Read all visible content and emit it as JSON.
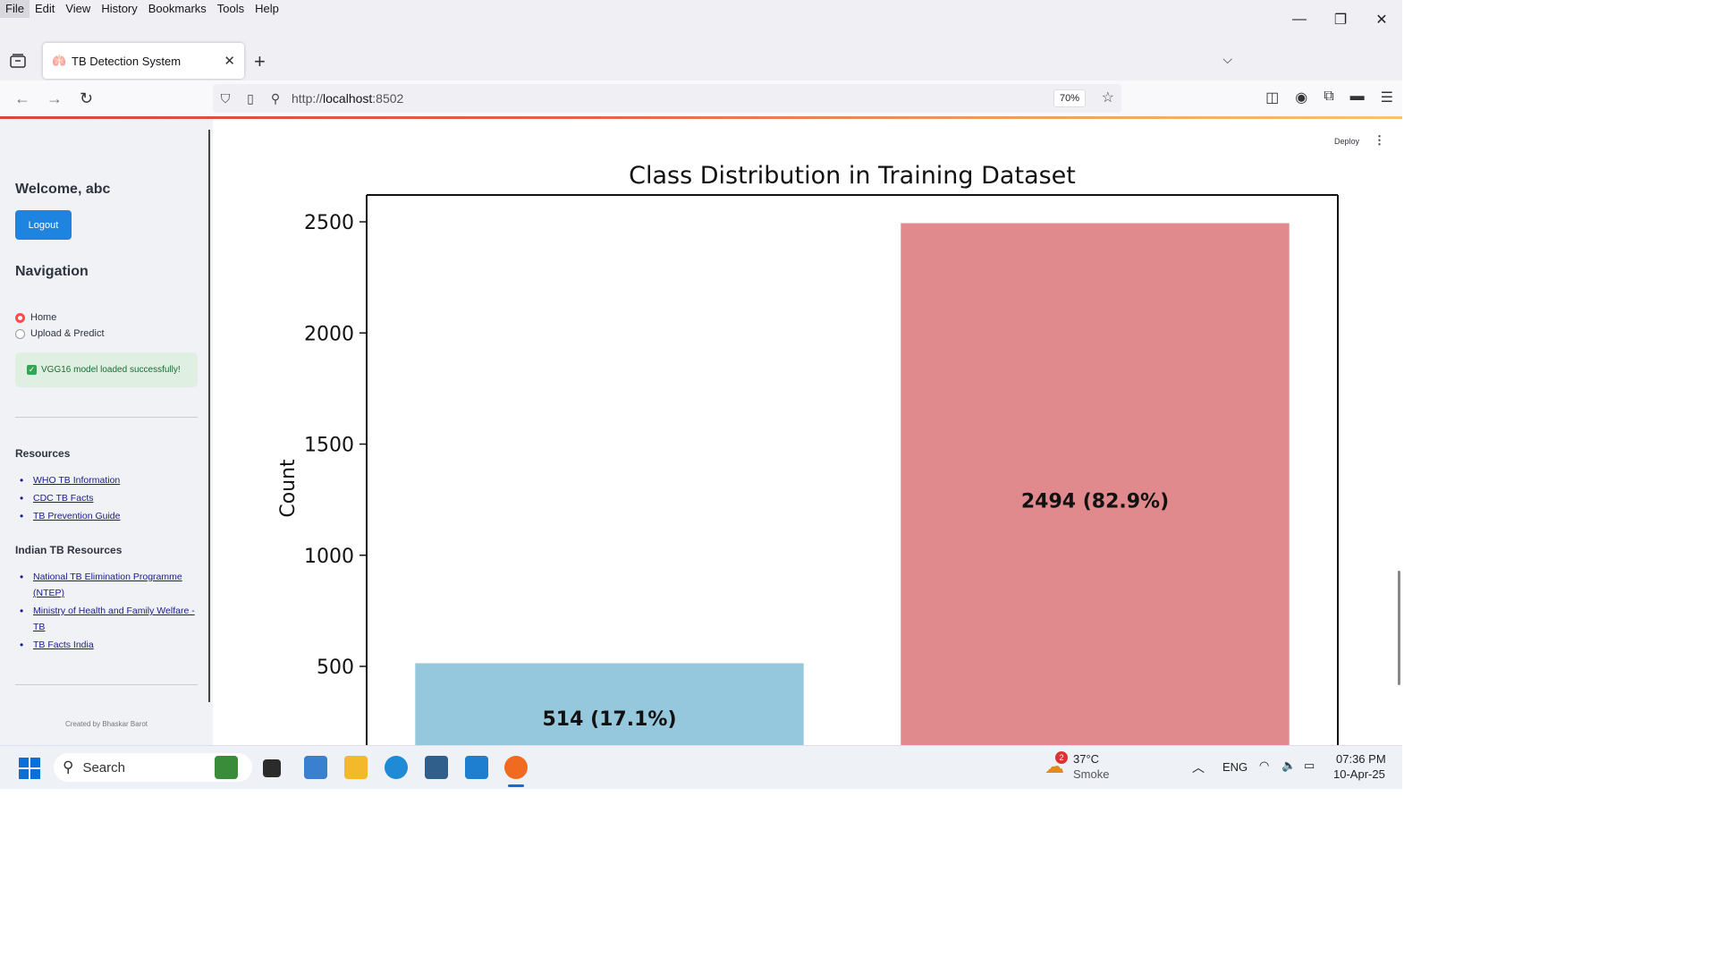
{
  "menu": [
    "File",
    "Edit",
    "View",
    "History",
    "Bookmarks",
    "Tools",
    "Help"
  ],
  "tab": {
    "title": "TB Detection System"
  },
  "urlbar": {
    "protocol": "http://",
    "host": "localhost",
    "port": ":8502",
    "zoom": "70%"
  },
  "sidebar": {
    "welcome": "Welcome, abc",
    "logout_label": "Logout",
    "nav_heading": "Navigation",
    "nav_options": [
      {
        "label": "Home",
        "selected": true
      },
      {
        "label": "Upload & Predict",
        "selected": false
      }
    ],
    "success_message": "VGG16 model loaded successfully!",
    "resources_heading": "Resources",
    "resources": [
      "WHO TB Information",
      "CDC TB Facts",
      "TB Prevention Guide"
    ],
    "indian_heading": "Indian TB Resources",
    "indian_resources": [
      "National TB Elimination Programme (NTEP)",
      "Ministry of Health and Family Welfare - TB",
      "TB Facts India"
    ],
    "credit": "Created by Bhaskar Barot"
  },
  "toolbar": {
    "deploy_label": "Deploy",
    "menu_icon": "kebab-icon"
  },
  "chart_data": {
    "type": "bar",
    "title": "Class Distribution in Training Dataset",
    "ylabel": "Count",
    "xlabel": "",
    "values": [
      514,
      2494
    ],
    "bar_labels": [
      "514 (17.1%)",
      "2494 (82.9%)"
    ],
    "colors": [
      "#95c8dc",
      "#e08a8d"
    ],
    "yticks": [
      "500",
      "1000",
      "1500",
      "2000",
      "2500"
    ],
    "ylim": [
      0,
      2620
    ]
  },
  "taskbar": {
    "search_placeholder": "Search",
    "weather_badge": "2",
    "temperature": "37°C",
    "condition": "Smoke",
    "language": "ENG",
    "time": "07:36 PM",
    "date": "10-Apr-25"
  }
}
